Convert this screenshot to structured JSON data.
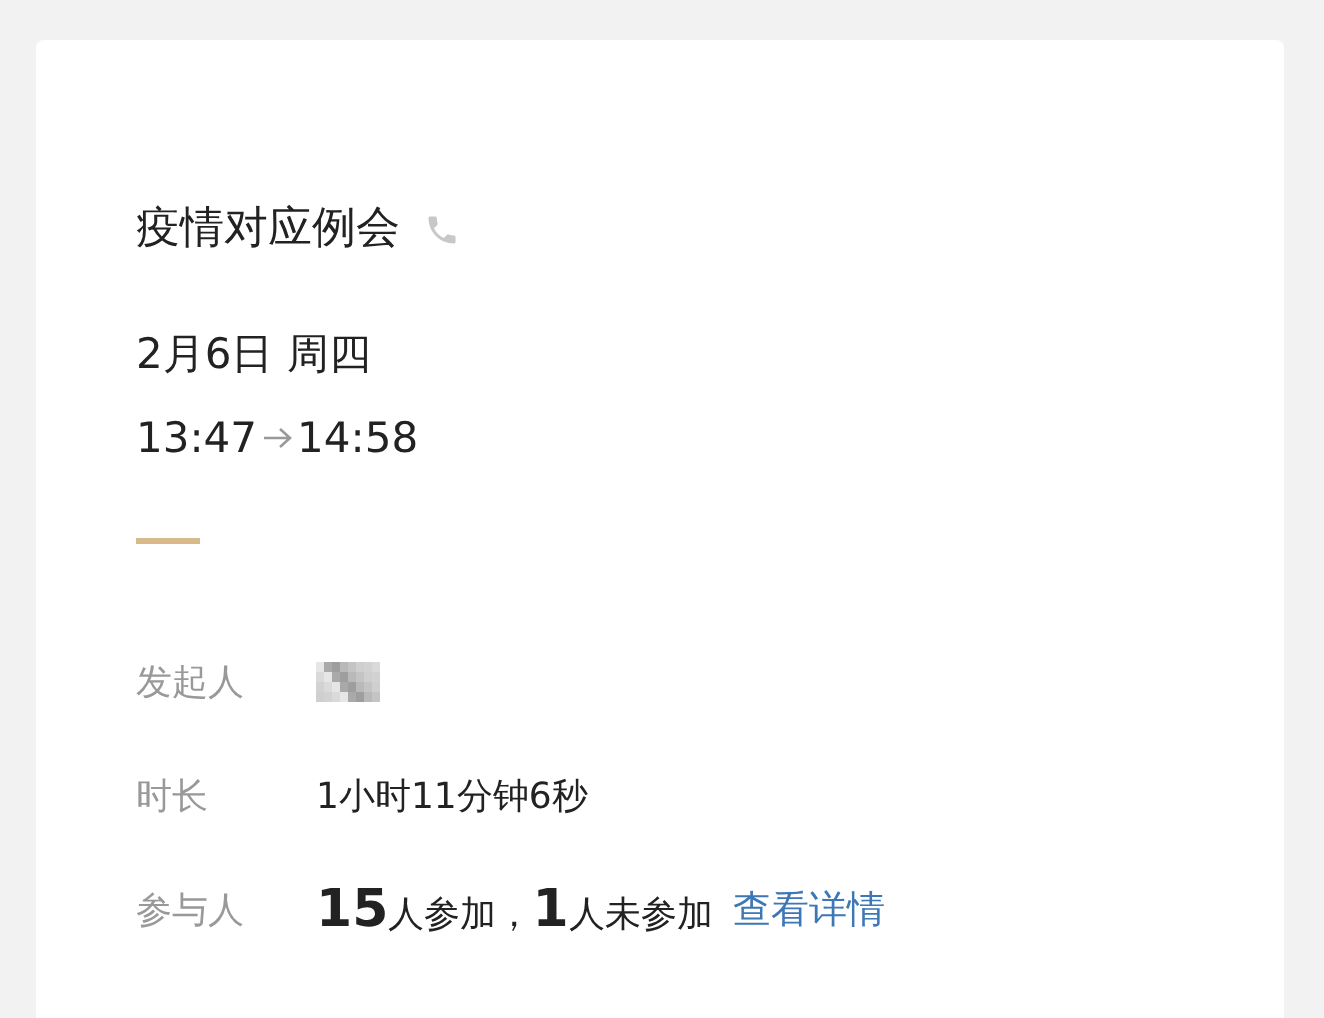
{
  "meeting": {
    "title": "疫情对应例会",
    "date": "2月6日 周四",
    "start": "13:47",
    "end": "14:58"
  },
  "details": [
    {
      "label": "发起人",
      "kind": "redacted"
    },
    {
      "label": "时长",
      "kind": "text",
      "value": "1小时11分钟6秒"
    },
    {
      "label": "参与人",
      "kind": "attendance",
      "value": "**15**人参加，**1**人未参加",
      "link": "查看详情"
    }
  ]
}
